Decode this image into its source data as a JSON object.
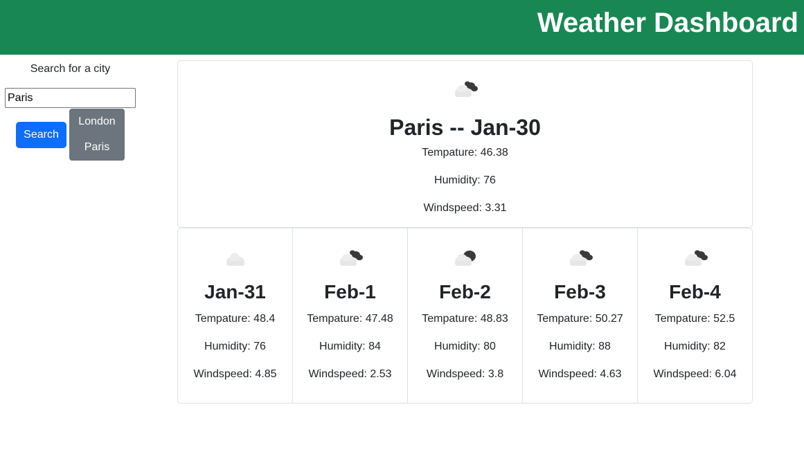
{
  "header": {
    "title": "Weather Dashboard"
  },
  "sidebar": {
    "search_label": "Search for a city",
    "search_value": "Paris",
    "search_button": "Search",
    "history": [
      "London",
      "Paris"
    ]
  },
  "today": {
    "title": "Paris -- Jan-30",
    "temp": "Tempature: 46.38",
    "humidity": "Humidity: 76",
    "wind": "Windspeed: 3.31",
    "icon": "broken-clouds-icon"
  },
  "forecast": [
    {
      "date": "Jan-31",
      "temp": "Tempature: 48.4",
      "humidity": "Humidity: 76",
      "wind": "Windspeed: 4.85",
      "icon": "few-clouds-icon"
    },
    {
      "date": "Feb-1",
      "temp": "Tempature: 47.48",
      "humidity": "Humidity: 84",
      "wind": "Windspeed: 2.53",
      "icon": "broken-clouds-icon"
    },
    {
      "date": "Feb-2",
      "temp": "Tempature: 48.83",
      "humidity": "Humidity: 80",
      "wind": "Windspeed: 3.8",
      "icon": "overcast-clouds-icon"
    },
    {
      "date": "Feb-3",
      "temp": "Tempature: 50.27",
      "humidity": "Humidity: 88",
      "wind": "Windspeed: 4.63",
      "icon": "broken-clouds-icon"
    },
    {
      "date": "Feb-4",
      "temp": "Tempature: 52.5",
      "humidity": "Humidity: 82",
      "wind": "Windspeed: 6.04",
      "icon": "broken-clouds-icon"
    }
  ],
  "colors": {
    "header": "#198754",
    "search_button": "#0d6efd",
    "history_bg": "#6c757d",
    "border": "#dee2e6"
  }
}
